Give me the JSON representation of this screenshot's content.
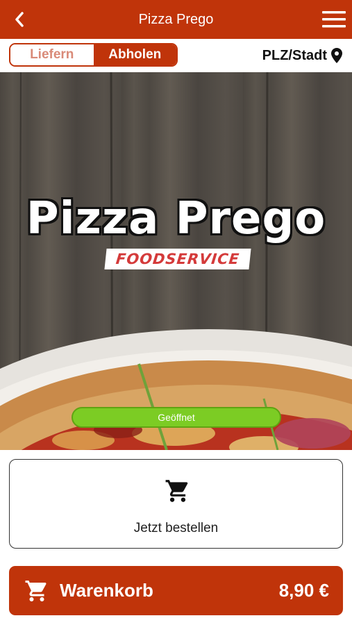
{
  "header": {
    "title": "Pizza Prego",
    "back_icon": "chevron-left-icon",
    "menu_icon": "hamburger-menu-icon"
  },
  "mode_toggle": {
    "options": [
      "Liefern",
      "Abholen"
    ],
    "selected": "Abholen"
  },
  "location": {
    "label": "PLZ/Stadt",
    "icon": "map-pin-icon"
  },
  "hero": {
    "logo_title": "Pizza Prego",
    "logo_subtitle": "FOODSERVICE",
    "status": "Geöffnet",
    "status_color": "#7ccc24"
  },
  "order_button": {
    "label": "Jetzt bestellen",
    "icon": "cart-icon"
  },
  "cart": {
    "label": "Warenkorb",
    "total": "8,90 €",
    "icon": "cart-icon"
  },
  "colors": {
    "brand": "#c0340a",
    "white": "#ffffff"
  }
}
